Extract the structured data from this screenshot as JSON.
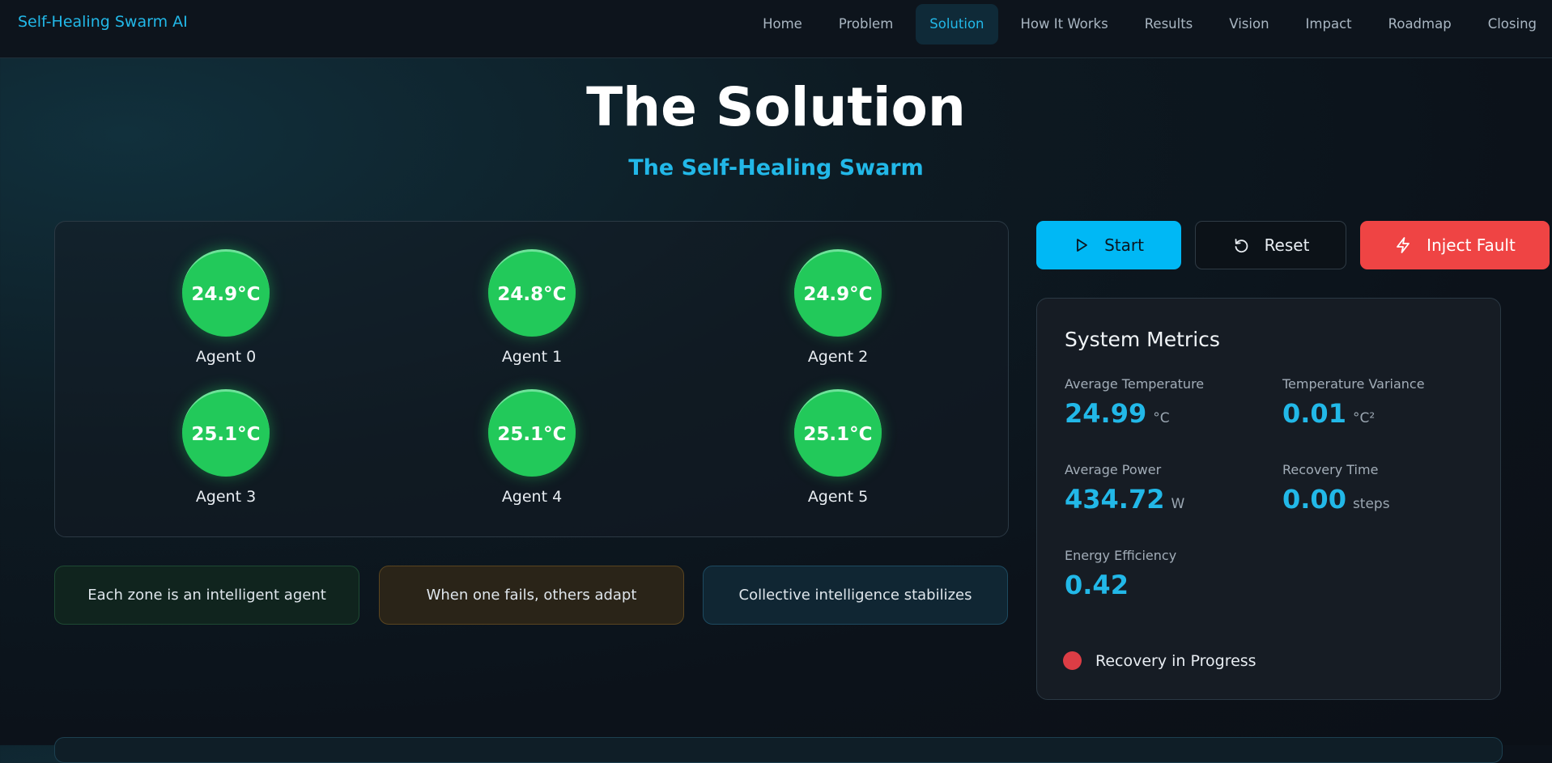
{
  "nav": {
    "brand": "Self-Healing Swarm AI",
    "links": [
      "Home",
      "Problem",
      "Solution",
      "How It Works",
      "Results",
      "Vision",
      "Impact",
      "Roadmap",
      "Closing"
    ],
    "active": "Solution"
  },
  "hero": {
    "title": "The Solution",
    "subtitle": "The Self-Healing Swarm"
  },
  "agents": [
    {
      "label": "Agent 0",
      "temp": "24.9°C"
    },
    {
      "label": "Agent 1",
      "temp": "24.8°C"
    },
    {
      "label": "Agent 2",
      "temp": "24.9°C"
    },
    {
      "label": "Agent 3",
      "temp": "25.1°C"
    },
    {
      "label": "Agent 4",
      "temp": "25.1°C"
    },
    {
      "label": "Agent 5",
      "temp": "25.1°C"
    }
  ],
  "features": [
    "Each zone is an intelligent agent",
    "When one fails, others adapt",
    "Collective intelligence stabilizes"
  ],
  "controls": {
    "start": "Start",
    "reset": "Reset",
    "inject": "Inject Fault"
  },
  "metrics": {
    "title": "System Metrics",
    "avg_temp": {
      "label": "Average Temperature",
      "value": "24.99",
      "unit": "°C"
    },
    "variance": {
      "label": "Temperature Variance",
      "value": "0.01",
      "unit": "°C²"
    },
    "avg_power": {
      "label": "Average Power",
      "value": "434.72",
      "unit": "W"
    },
    "recovery": {
      "label": "Recovery Time",
      "value": "0.00",
      "unit": "steps"
    },
    "efficiency": {
      "label": "Energy Efficiency",
      "value": "0.42"
    }
  },
  "status": {
    "text": "Recovery in Progress",
    "color": "#dc3d45"
  },
  "colors": {
    "accent": "#22b8e8",
    "agent_ok": "#22c95a",
    "danger": "#ef4444"
  }
}
